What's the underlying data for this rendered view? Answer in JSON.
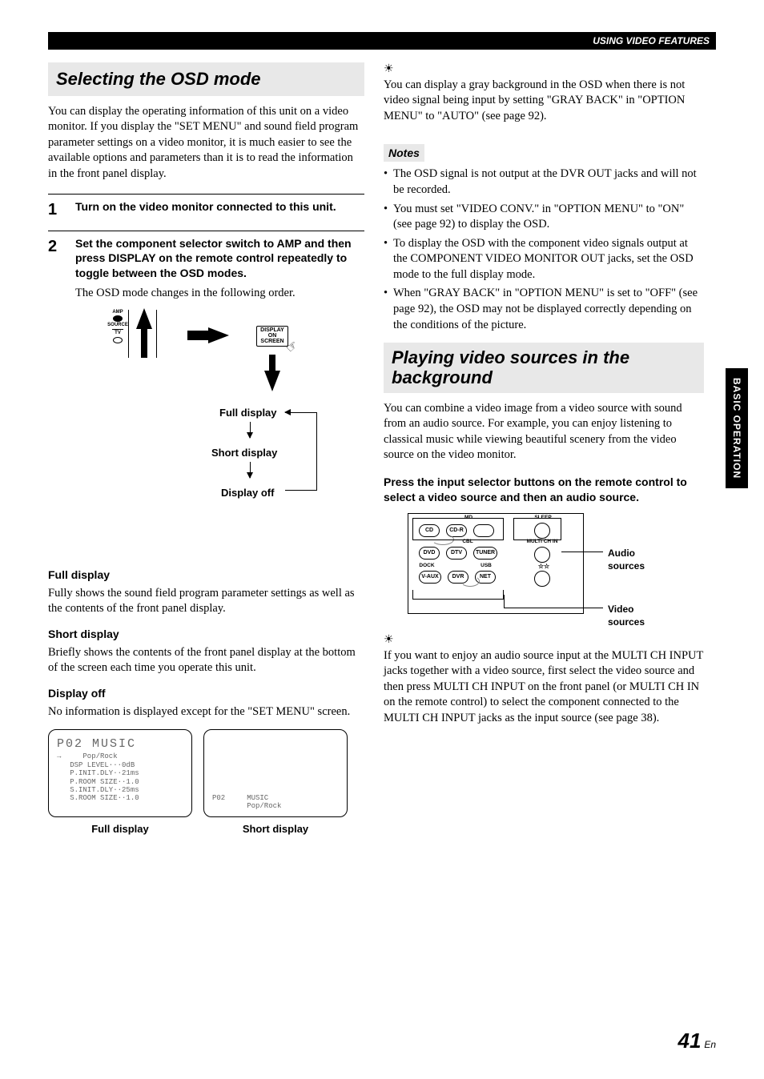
{
  "header": {
    "section": "USING VIDEO FEATURES"
  },
  "left": {
    "title": "Selecting the OSD mode",
    "intro": "You can display the operating information of this unit on a video monitor. If you display the \"SET MENU\" and sound field program parameter settings on a video monitor, it is much easier to see the available options and parameters than it is to read the information in the front panel display.",
    "step1": {
      "num": "1",
      "title": "Turn on the video monitor connected to this unit."
    },
    "step2": {
      "num": "2",
      "title": "Set the component selector switch to AMP and then press DISPLAY on the remote control repeatedly to toggle between the OSD modes.",
      "desc": "The OSD mode changes in the following order."
    },
    "diagram": {
      "switch_amp": "AMP",
      "switch_source": "SOURCE",
      "switch_tv": "TV",
      "btn_display": "DISPLAY",
      "btn_onscreen": "ON SCREEN",
      "flow_full": "Full display",
      "flow_short": "Short display",
      "flow_off": "Display off"
    },
    "full_h": "Full display",
    "full_p": "Fully shows the sound field program parameter settings as well as the contents of the front panel display.",
    "short_h": "Short display",
    "short_p": "Briefly shows the contents of the front panel display at the bottom of the screen each time you operate this unit.",
    "off_h": "Display off",
    "off_p": "No information is displayed except for the \"SET MENU\" screen.",
    "osd_full": {
      "title": "P02   MUSIC",
      "l1": "→     Pop/Rock",
      "l2": "   DSP LEVEL···0dB",
      "l3": "   P.INIT.DLY··21ms",
      "l4": "   P.ROOM SIZE··1.0",
      "l5": "   S.INIT.DLY··25ms",
      "l6": "   S.ROOM SIZE··1.0",
      "caption": "Full display"
    },
    "osd_short": {
      "l1": "P02     MUSIC",
      "l2": "        Pop/Rock",
      "caption": "Short display"
    }
  },
  "right": {
    "tip1": "You can display a gray background in the OSD when there is not video signal being input by setting \"GRAY BACK\" in \"OPTION MENU\" to \"AUTO\" (see page 92).",
    "notes_h": "Notes",
    "note1": "The OSD signal is not output at the DVR OUT jacks and will not be recorded.",
    "note2": "You must set \"VIDEO CONV.\" in \"OPTION MENU\" to \"ON\" (see page 92) to display the OSD.",
    "note3": "To display the OSD with the component video signals output at the COMPONENT VIDEO MONITOR OUT jacks, set the OSD mode to the full display mode.",
    "note4": "When \"GRAY BACK\" in \"OPTION MENU\" is set to \"OFF\" (see page 92), the OSD may not be displayed correctly depending on the conditions of the picture.",
    "title2": "Playing video sources in the background",
    "intro2": "You can combine a video image from a video source with sound from an audio source. For example, you can enjoy listening to classical music while viewing beautiful scenery from the video source on the video monitor.",
    "instr2": "Press the input selector buttons on the remote control to select a video source and then an audio source.",
    "remote": {
      "cd": "CD",
      "md": "MD",
      "cdr": "CD-R",
      "cbl": "CBL",
      "dvd": "DVD",
      "dtv": "DTV",
      "tuner": "TUNER",
      "dock": "DOCK",
      "usb": "USB",
      "vaux": "V-AUX",
      "dvr": "DVR",
      "net": "NET",
      "sleep": "SLEEP",
      "multi": "MULTI CH IN",
      "audio_label": "Audio sources",
      "video_label": "Video sources"
    },
    "tip2": "If you want to enjoy an audio source input at the MULTI CH INPUT jacks together with a video source, first select the video source and then press MULTI CH INPUT on the front panel (or MULTI CH IN on the remote control) to select the component connected to the MULTI CH INPUT jacks as the input source (see page 38)."
  },
  "sidetab": "BASIC OPERATION",
  "page": {
    "num": "41",
    "suffix": "En"
  }
}
